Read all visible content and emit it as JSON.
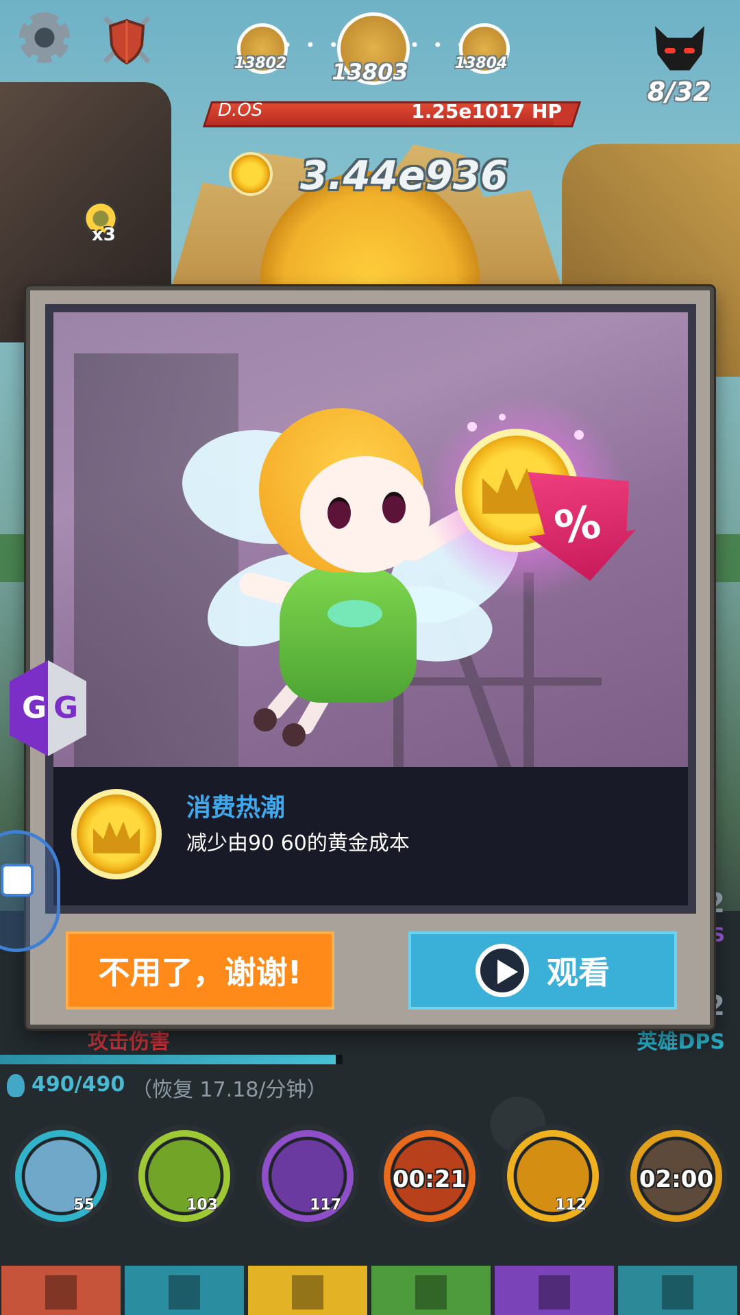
{
  "hud": {
    "stages": {
      "prev": "13802",
      "current": "13803",
      "next": "13804"
    },
    "dots": "• • • •",
    "kills": "8/32",
    "boss": {
      "name": "D.OS",
      "hp": "1.25e1017 HP",
      "hp_fraction": 0.95
    },
    "gold": "3.44e936",
    "multiplier": "x3"
  },
  "modal": {
    "title": "消费热潮",
    "description": "减少由90 60的黄金成本",
    "decline_label": "不用了，谢谢!",
    "watch_label": "观看",
    "percent_symbol": "%"
  },
  "overlays": {
    "gg_left": "G",
    "gg_right": "G"
  },
  "stats": {
    "attack_label": "攻击伤害",
    "hero_dps_label": "英雄DPS",
    "right_value_1": "2",
    "right_value_1_suffix": "S",
    "right_value_2": "2",
    "mana": "490/490",
    "regen": "（恢复 17.18/分钟）",
    "mana_fraction": 1.0
  },
  "skills": [
    {
      "name": "heavenly-strike",
      "level": "55",
      "ring": "#31b3c9",
      "inner": "#6fa8c8"
    },
    {
      "name": "shadow-clone",
      "level": "103",
      "ring": "#9ec934",
      "inner": "#72a427"
    },
    {
      "name": "hand-of-midas",
      "level": "117",
      "ring": "#8f4fc9",
      "inner": "#6b3aa0"
    },
    {
      "name": "war-cry",
      "timer": "00:21",
      "ring": "#e86a1c",
      "inner": "#b8411c"
    },
    {
      "name": "deadly-strike",
      "level": "112",
      "ring": "#f0b11e",
      "inner": "#d48f12"
    },
    {
      "name": "berserker-rage",
      "timer": "02:00",
      "ring": "#e0a01c",
      "inner": "#5d4a3a"
    }
  ],
  "tabs": [
    {
      "name": "sword-tab",
      "color": "#c5543a"
    },
    {
      "name": "heroes-tab",
      "color": "#2b8ea0"
    },
    {
      "name": "equipment-tab",
      "color": "#e4b325"
    },
    {
      "name": "pets-tab",
      "color": "#4e9b3e"
    },
    {
      "name": "artifacts-tab",
      "color": "#7b43b8"
    },
    {
      "name": "shop-tab",
      "color": "#2c8a98"
    }
  ]
}
